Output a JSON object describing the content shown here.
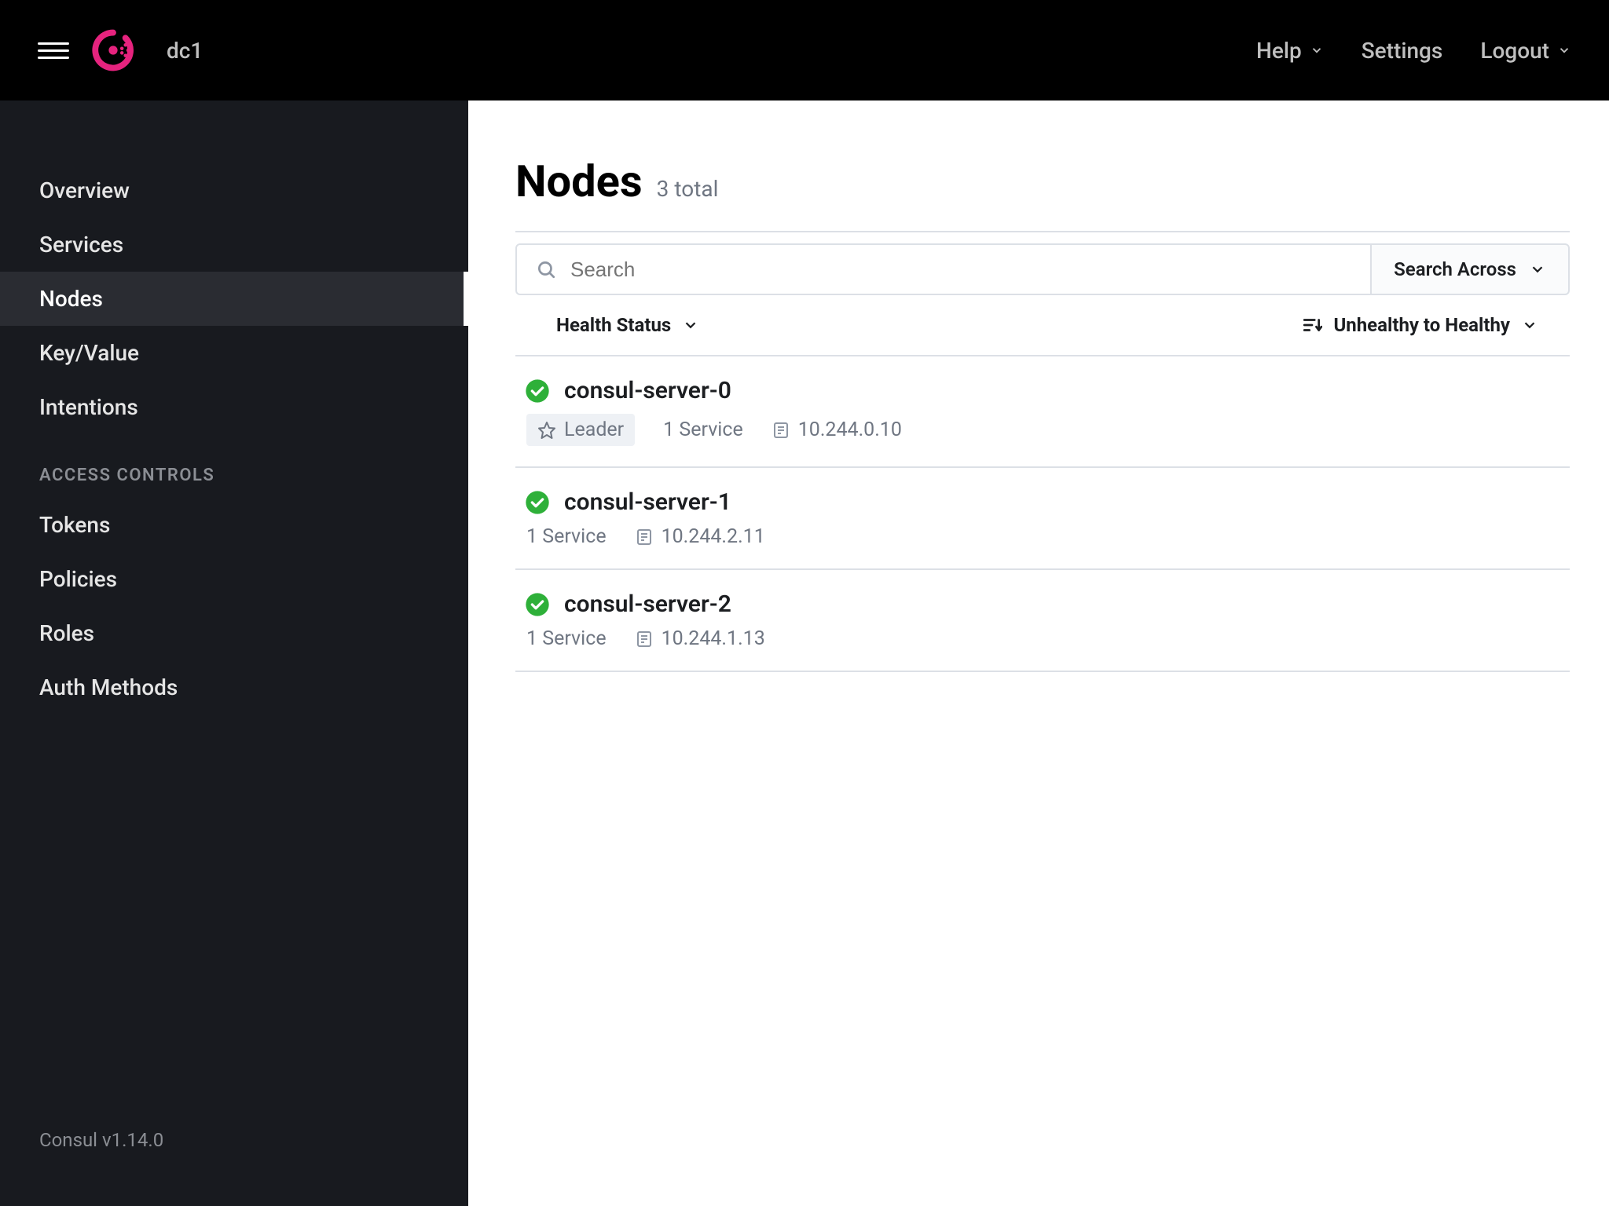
{
  "topbar": {
    "datacenter": "dc1",
    "help": "Help",
    "settings": "Settings",
    "logout": "Logout"
  },
  "sidebar": {
    "items": [
      {
        "label": "Overview",
        "active": false
      },
      {
        "label": "Services",
        "active": false
      },
      {
        "label": "Nodes",
        "active": true
      },
      {
        "label": "Key/Value",
        "active": false
      },
      {
        "label": "Intentions",
        "active": false
      }
    ],
    "access_section_label": "ACCESS CONTROLS",
    "access_items": [
      {
        "label": "Tokens"
      },
      {
        "label": "Policies"
      },
      {
        "label": "Roles"
      },
      {
        "label": "Auth Methods"
      }
    ],
    "footer": "Consul v1.14.0"
  },
  "page": {
    "title": "Nodes",
    "subtitle": "3 total"
  },
  "search": {
    "placeholder": "Search",
    "across_label": "Search Across"
  },
  "filters": {
    "health_status": "Health Status",
    "sort_label": "Unhealthy to Healthy"
  },
  "nodes": [
    {
      "name": "consul-server-0",
      "leader": true,
      "leader_label": "Leader",
      "services": "1 Service",
      "ip": "10.244.0.10"
    },
    {
      "name": "consul-server-1",
      "leader": false,
      "services": "1 Service",
      "ip": "10.244.2.11"
    },
    {
      "name": "consul-server-2",
      "leader": false,
      "services": "1 Service",
      "ip": "10.244.1.13"
    }
  ],
  "colors": {
    "accent": "#e6237e",
    "healthy": "#2eb039"
  }
}
